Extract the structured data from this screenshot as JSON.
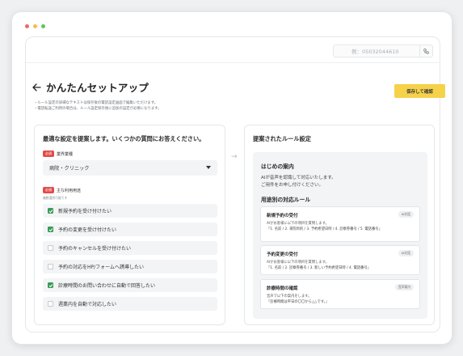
{
  "window": {
    "dots": [
      "#ee6a5f",
      "#f5be4f",
      "#61c554"
    ]
  },
  "topbar": {
    "phone_placeholder": "例：05032044610",
    "phone_icon": "phone-icon"
  },
  "header": {
    "title": "かんたんセットアップ",
    "notes": [
      "・ルール設定の詳細なテキストは保存後の電話設定画面で編集いただけます。",
      "・電話転送ご利用の場合は、ルール設定保存後に追加の設定が必要になります。"
    ],
    "save_label": "保存して確認"
  },
  "left": {
    "title": "最適な設定を提案します。いくつかの質問にお答えください。",
    "required_badge": "必須",
    "industry_label": "業界業種",
    "industry_value": "病院・クリニック",
    "purpose_label": "主な利用用途",
    "purpose_sublabel": "複数選択可能です",
    "options": [
      {
        "label": "新規予約を受け付けたい",
        "checked": true
      },
      {
        "label": "予約の変更を受け付けたい",
        "checked": true
      },
      {
        "label": "予約のキャンセルを受け付けたい",
        "checked": false
      },
      {
        "label": "予約の対応をHP/フォームへ誘導したい",
        "checked": false
      },
      {
        "label": "診療時間のお問い合わせに自動で回答したい",
        "checked": true
      },
      {
        "label": "週業内を自動で対応したい",
        "checked": false
      }
    ]
  },
  "right": {
    "title": "提案されたルール設定",
    "intro_title": "はじめの案内",
    "intro_lines": [
      "AIが音声を認識して対応いたします。",
      "ご用件をお申し付けください。"
    ],
    "rules_title": "用途別の対応ルール",
    "cards": [
      {
        "title": "新規予約の受付",
        "tag": "AI対話",
        "desc": "AIがお客様に以下の項目を質問します。",
        "detail": "「1. 名前 / 2. 来院目的 / 3. 予約希望日時 / 4. 診察券番号 / 5. 電話番号」"
      },
      {
        "title": "予約変更の受付",
        "tag": "AI対話",
        "desc": "AIがお客様に以下の項目を質問します。",
        "detail": "「1. 名前 / 2. 診察券番号 / 3. 新しい予約希望日時 / 4. 電話番号」"
      },
      {
        "title": "診療時間の確認",
        "tag": "音声案内",
        "desc": "音声で以下の案内をします。",
        "detail": "「診療時間は平日の〇〇から△△です。」"
      }
    ]
  }
}
